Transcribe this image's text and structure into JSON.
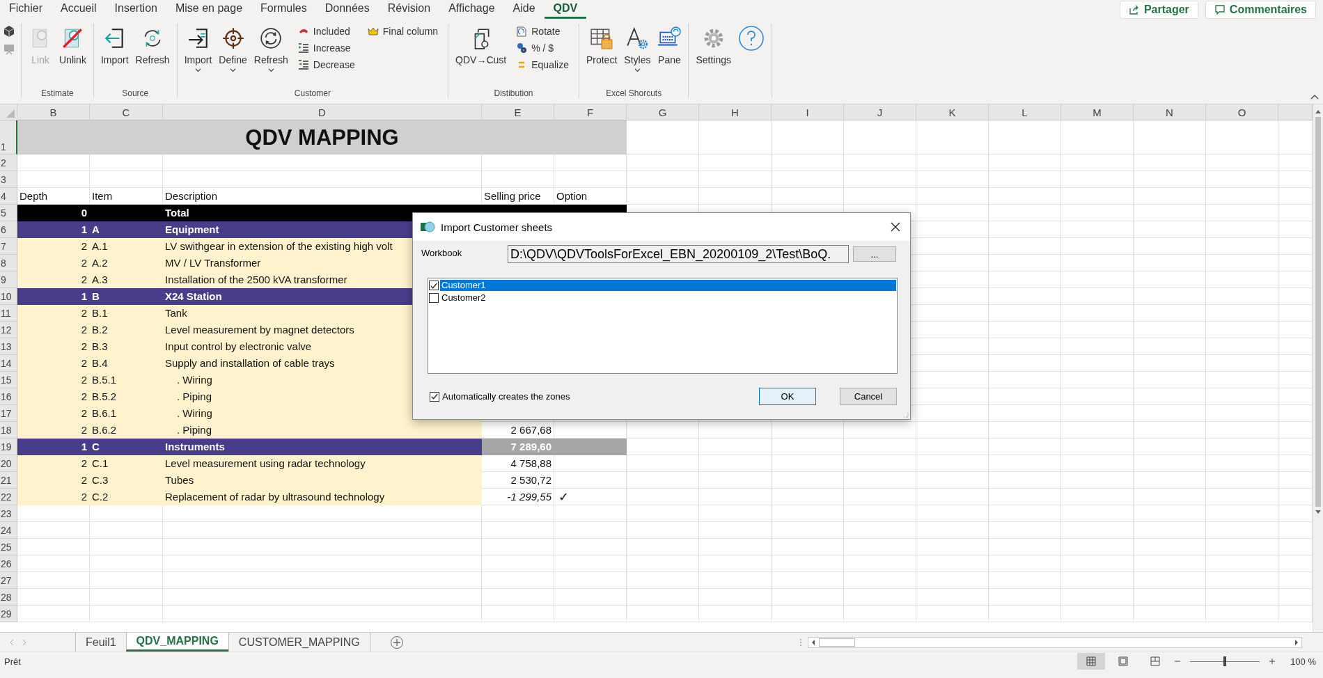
{
  "menu_tabs": [
    {
      "label": "Fichier",
      "selected": false
    },
    {
      "label": "Accueil",
      "selected": false
    },
    {
      "label": "Insertion",
      "selected": false
    },
    {
      "label": "Mise en page",
      "selected": false
    },
    {
      "label": "Formules",
      "selected": false
    },
    {
      "label": "Données",
      "selected": false
    },
    {
      "label": "Révision",
      "selected": false
    },
    {
      "label": "Affichage",
      "selected": false
    },
    {
      "label": "Aide",
      "selected": false
    },
    {
      "label": "QDV",
      "selected": true
    }
  ],
  "top_buttons": [
    "Partager",
    "Commentaires"
  ],
  "ribbon": {
    "groups": [
      {
        "label": "Estimate",
        "items": [
          {
            "label": "Link",
            "kind": "large",
            "disabled": true,
            "dropdown": false
          },
          {
            "label": "Unlink",
            "kind": "large",
            "disabled": false,
            "dropdown": false
          }
        ]
      },
      {
        "label": "Source",
        "items": [
          {
            "label": "Import",
            "kind": "large",
            "disabled": false,
            "dropdown": false
          },
          {
            "label": "Refresh",
            "kind": "large",
            "disabled": false,
            "dropdown": false
          }
        ]
      },
      {
        "label": "Customer",
        "items": [
          {
            "label": "Import",
            "kind": "large",
            "disabled": false,
            "dropdown": true
          },
          {
            "label": "Define",
            "kind": "large",
            "disabled": false,
            "dropdown": true
          },
          {
            "label": "Refresh",
            "kind": "large",
            "disabled": false,
            "dropdown": true
          },
          {
            "label": "Included",
            "kind": "small",
            "disabled": false
          },
          {
            "label": "Increase",
            "kind": "small",
            "disabled": false
          },
          {
            "label": "Decrease",
            "kind": "small",
            "disabled": false
          },
          {
            "label": "Final column",
            "kind": "small",
            "disabled": false
          }
        ]
      },
      {
        "label": "Distibution",
        "items": [
          {
            "label": "QDV→Cust",
            "kind": "large",
            "disabled": false,
            "dropdown": false
          },
          {
            "label": "Rotate",
            "kind": "small",
            "disabled": false
          },
          {
            "label": "% / $",
            "kind": "small",
            "disabled": false
          },
          {
            "label": "Equalize",
            "kind": "small",
            "disabled": false
          }
        ]
      },
      {
        "label": "Excel Shorcuts",
        "items": [
          {
            "label": "Protect",
            "kind": "large",
            "disabled": false,
            "dropdown": false
          },
          {
            "label": "Styles",
            "kind": "large",
            "disabled": false,
            "dropdown": true
          },
          {
            "label": "Pane",
            "kind": "large",
            "disabled": false,
            "dropdown": false
          }
        ]
      },
      {
        "items": [
          {
            "label": "Settings",
            "kind": "large",
            "disabled": false,
            "dropdown": false
          }
        ]
      }
    ]
  },
  "sheet": {
    "columns": [
      "B",
      "C",
      "D",
      "E",
      "F",
      "G",
      "H",
      "I",
      "J",
      "K",
      "L",
      "M",
      "N",
      "O"
    ],
    "rows": [
      {
        "number": "1",
        "kind": "title",
        "title": "QDV MAPPING"
      },
      {
        "number": "2",
        "kind": "blank"
      },
      {
        "number": "3",
        "kind": "blank"
      },
      {
        "number": "4",
        "kind": "header",
        "depth": "Depth",
        "item": "Item",
        "description": "Description",
        "price": "Selling price",
        "option": "Option"
      },
      {
        "number": "5",
        "kind": "total",
        "depth": "0",
        "description": "Total"
      },
      {
        "number": "6",
        "kind": "group",
        "depth": "1",
        "item": "A",
        "description": "Equipment"
      },
      {
        "number": "7",
        "kind": "item",
        "depth": "2",
        "item": "A.1",
        "description": "LV swithgear in extension of the existing high volt"
      },
      {
        "number": "8",
        "kind": "item",
        "depth": "2",
        "item": "A.2",
        "description": "MV / LV Transformer"
      },
      {
        "number": "9",
        "kind": "item",
        "depth": "2",
        "item": "A.3",
        "description": "Installation of the 2500 kVA transformer"
      },
      {
        "number": "10",
        "kind": "group",
        "depth": "1",
        "item": "B",
        "description": "X24 Station"
      },
      {
        "number": "11",
        "kind": "item",
        "depth": "2",
        "item": "B.1",
        "description": "Tank"
      },
      {
        "number": "12",
        "kind": "item",
        "depth": "2",
        "item": "B.2",
        "description": "Level measurement by magnet detectors"
      },
      {
        "number": "13",
        "kind": "item",
        "depth": "2",
        "item": "B.3",
        "description": "Input control by electronic valve"
      },
      {
        "number": "14",
        "kind": "item",
        "depth": "2",
        "item": "B.4",
        "description": "Supply and installation of cable trays"
      },
      {
        "number": "15",
        "kind": "subitem",
        "depth": "2",
        "item": "B.5.1",
        "description": ". Wiring"
      },
      {
        "number": "16",
        "kind": "subitem",
        "depth": "2",
        "item": "B.5.2",
        "description": ". Piping"
      },
      {
        "number": "17",
        "kind": "subitem",
        "depth": "2",
        "item": "B.6.1",
        "description": ". Wiring"
      },
      {
        "number": "18",
        "kind": "subitem",
        "depth": "2",
        "item": "B.6.2",
        "description": ". Piping",
        "price": "2 667,68"
      },
      {
        "number": "19",
        "kind": "group",
        "depth": "1",
        "item": "C",
        "description": "Instruments",
        "price": "7 289,60"
      },
      {
        "number": "20",
        "kind": "item",
        "depth": "2",
        "item": "C.1",
        "description": "Level measurement using radar technology",
        "price": "4 758,88"
      },
      {
        "number": "21",
        "kind": "item",
        "depth": "2",
        "item": "C.3",
        "description": "Tubes",
        "price": "2 530,72"
      },
      {
        "number": "22",
        "kind": "item",
        "depth": "2",
        "item": "C.2",
        "description": "Replacement of radar by ultrasound technology",
        "price": "-1 299,55",
        "optional": true,
        "option": "✓"
      },
      {
        "number": "23",
        "kind": "blank"
      },
      {
        "number": "24",
        "kind": "blank"
      },
      {
        "number": "25",
        "kind": "blank"
      },
      {
        "number": "26",
        "kind": "blank"
      },
      {
        "number": "27",
        "kind": "blank"
      },
      {
        "number": "28",
        "kind": "blank"
      },
      {
        "number": "29",
        "kind": "blank"
      }
    ]
  },
  "dialog": {
    "title": "Import Customer sheets",
    "workbook_label": "Workbook",
    "workbook_path": "D:\\QDV\\QDVToolsForExcel_EBN_20200109_2\\Test\\BoQ.",
    "browse": "...",
    "sheets": [
      {
        "label": "Customer1",
        "checked": true,
        "selected": true
      },
      {
        "label": "Customer2",
        "checked": false,
        "selected": false
      }
    ],
    "auto_zones": {
      "label": "Automatically creates the zones",
      "checked": true
    },
    "buttons": [
      {
        "label": "OK",
        "default": true
      },
      {
        "label": "Cancel",
        "default": false
      }
    ]
  },
  "sheet_tabs": [
    {
      "label": "Feuil1",
      "selected": false
    },
    {
      "label": "QDV_MAPPING",
      "selected": true
    },
    {
      "label": "CUSTOMER_MAPPING",
      "selected": false
    }
  ],
  "status_bar": {
    "status": "Prêt",
    "views": [
      {
        "selected": true
      },
      {
        "selected": false
      },
      {
        "selected": false
      }
    ],
    "zoom": {
      "level": 0.5,
      "reading": "100 %"
    }
  }
}
